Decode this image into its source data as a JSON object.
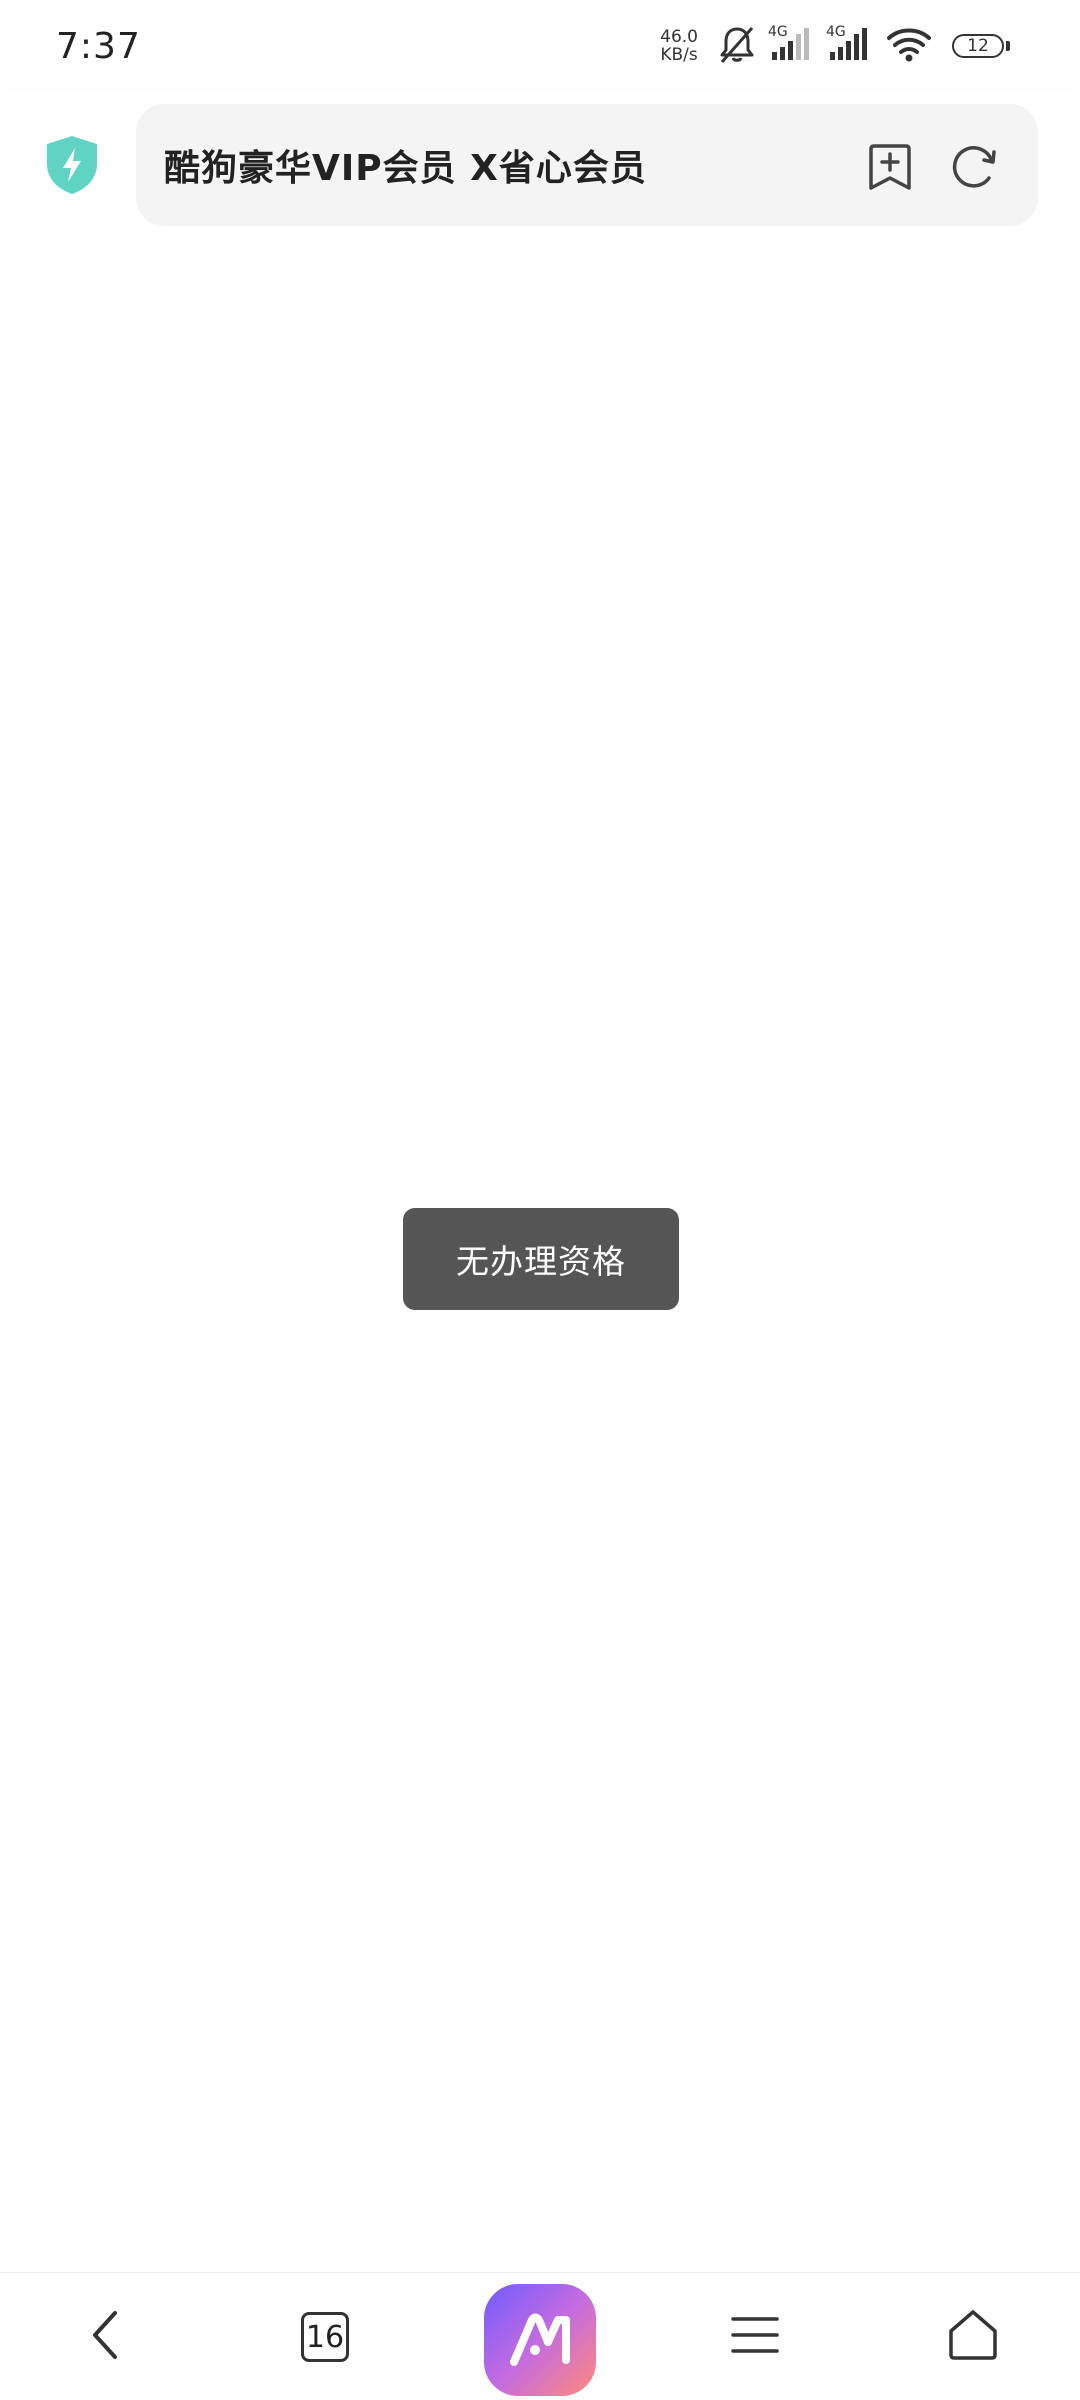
{
  "status_bar": {
    "time": "7:37",
    "net_speed_value": "46.0",
    "net_speed_unit": "KB/s",
    "sim1_tag": "4G",
    "sim2_tag": "4G",
    "battery_level": "12"
  },
  "toolbar": {
    "page_title": "酷狗豪华VIP会员 X省心会员"
  },
  "toast": {
    "message": "无办理资格"
  },
  "bottom_nav": {
    "tab_count": "16"
  },
  "colors": {
    "shield": "#5fd4c4",
    "toast_bg": "#555555",
    "icon": "#333333"
  }
}
